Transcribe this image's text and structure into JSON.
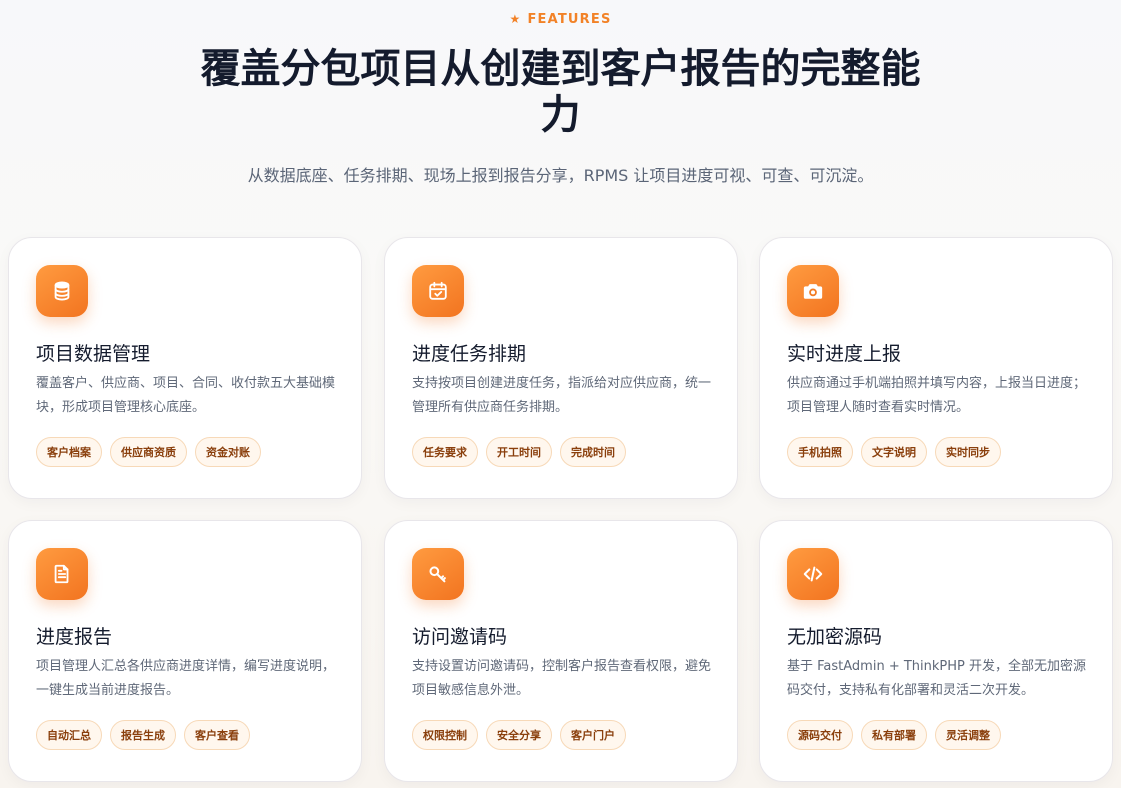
{
  "header": {
    "eyebrow": "FEATURES",
    "eyebrow_icon": "star-icon",
    "title": "覆盖分包项目从创建到客户报告的完整能力",
    "subtitle": "从数据底座、任务排期、现场上报到报告分享，RPMS 让项目进度可视、可查、可沉淀。"
  },
  "accent_color": "#f27c24",
  "cards": [
    {
      "icon": "database-icon",
      "title": "项目数据管理",
      "desc": "覆盖客户、供应商、项目、合同、收付款五大基础模块，形成项目管理核心底座。",
      "tags": [
        "客户档案",
        "供应商资质",
        "资金对账"
      ]
    },
    {
      "icon": "calendar-check-icon",
      "title": "进度任务排期",
      "desc": "支持按项目创建进度任务，指派给对应供应商，统一管理所有供应商任务排期。",
      "tags": [
        "任务要求",
        "开工时间",
        "完成时间"
      ]
    },
    {
      "icon": "camera-icon",
      "title": "实时进度上报",
      "desc": "供应商通过手机端拍照并填写内容，上报当日进度；项目管理人随时查看实时情况。",
      "tags": [
        "手机拍照",
        "文字说明",
        "实时同步"
      ]
    },
    {
      "icon": "document-icon",
      "title": "进度报告",
      "desc": "项目管理人汇总各供应商进度详情，编写进度说明，一键生成当前进度报告。",
      "tags": [
        "自动汇总",
        "报告生成",
        "客户查看"
      ]
    },
    {
      "icon": "key-icon",
      "title": "访问邀请码",
      "desc": "支持设置访问邀请码，控制客户报告查看权限，避免项目敏感信息外泄。",
      "tags": [
        "权限控制",
        "安全分享",
        "客户门户"
      ]
    },
    {
      "icon": "code-icon",
      "title": "无加密源码",
      "desc": "基于 FastAdmin + ThinkPHP 开发，全部无加密源码交付，支持私有化部署和灵活二次开发。",
      "tags": [
        "源码交付",
        "私有部署",
        "灵活调整"
      ]
    }
  ]
}
